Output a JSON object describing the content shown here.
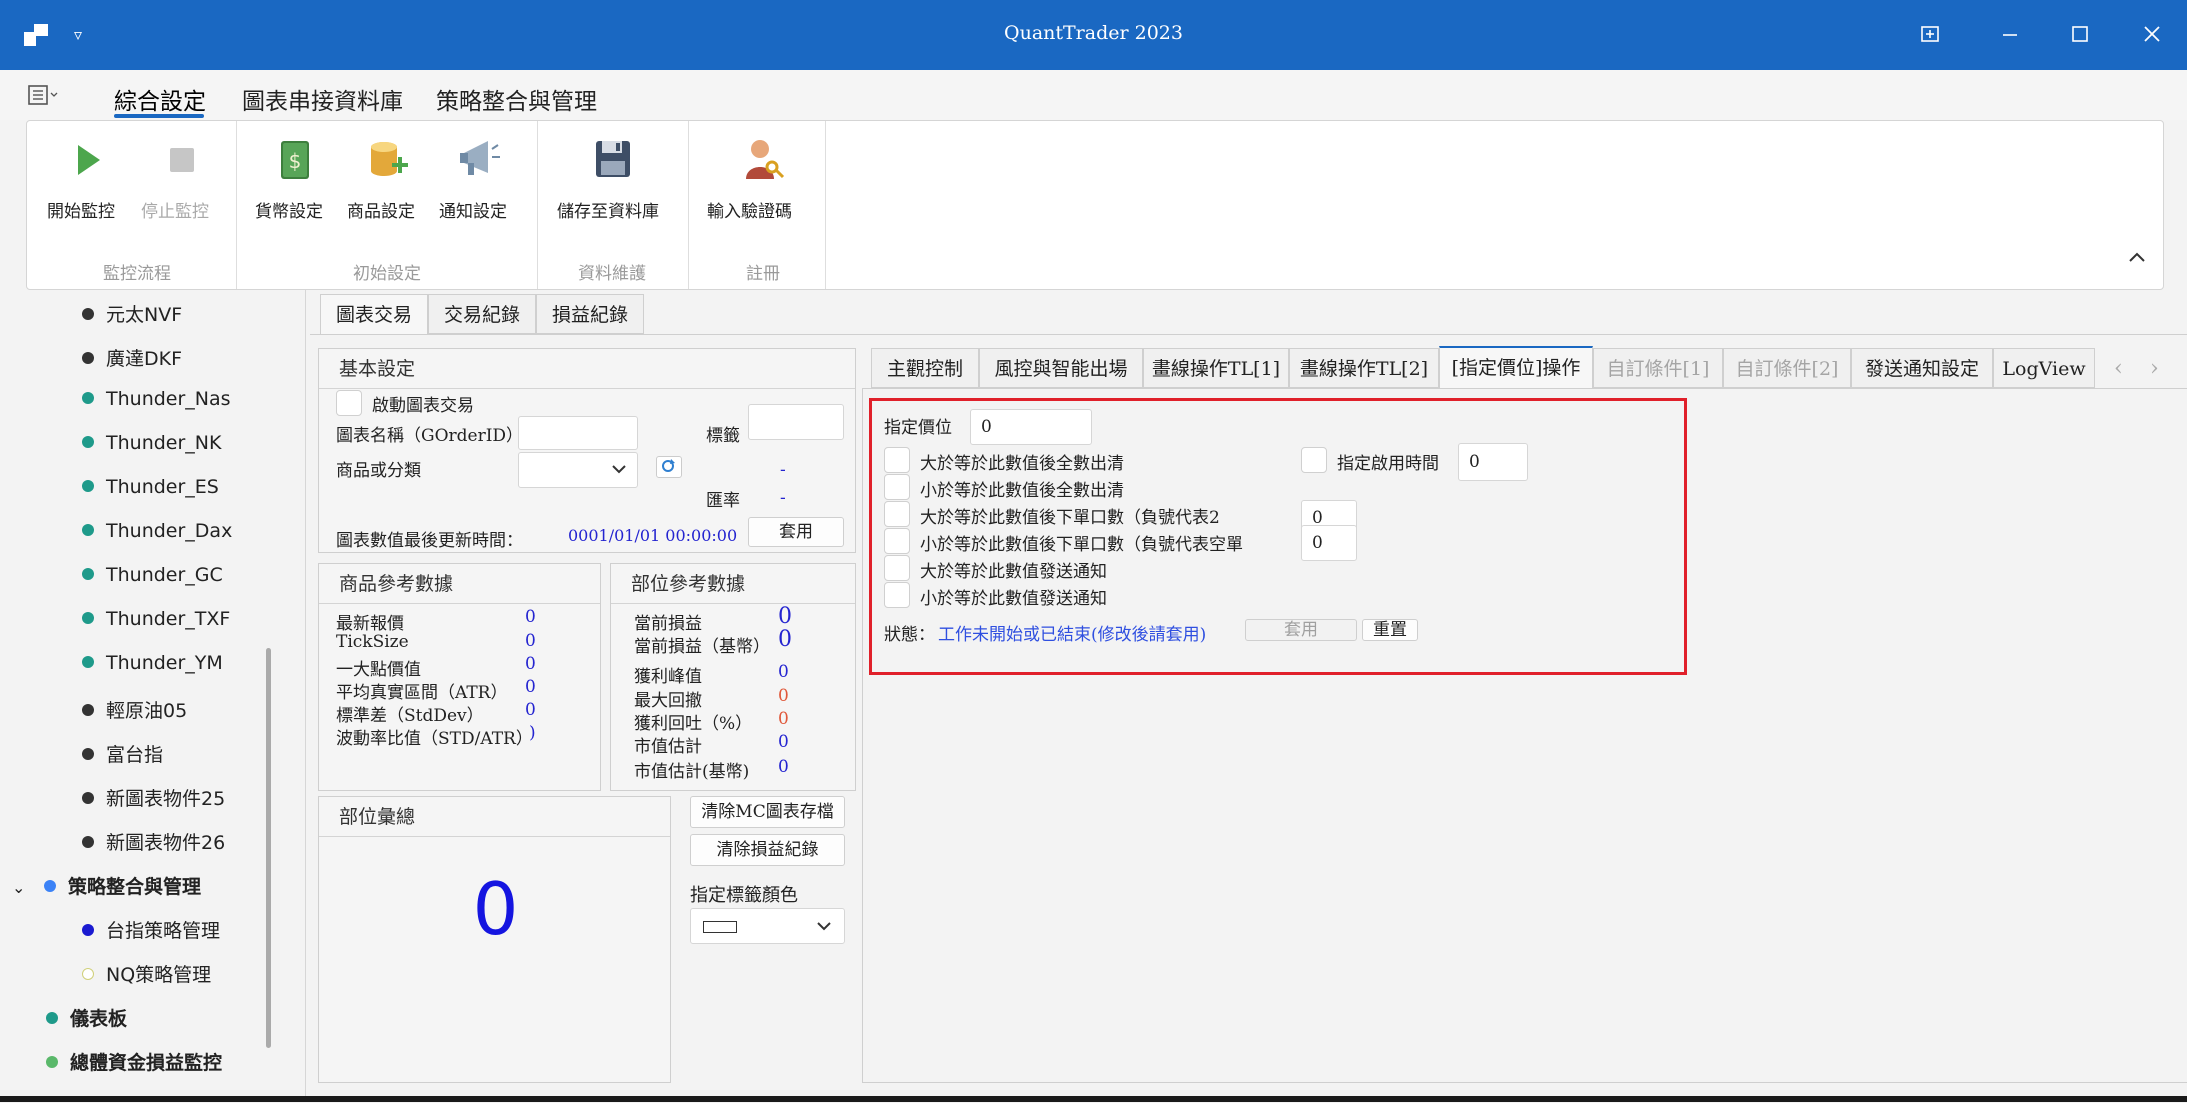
{
  "window": {
    "title": "QuantTrader 2023"
  },
  "menu": {
    "tabs": [
      "綜合設定",
      "圖表串接資料庫",
      "策略整合與管理"
    ]
  },
  "ribbon": {
    "buttons": [
      "開始監控",
      "停止監控",
      "貨幣設定",
      "商品設定",
      "通知設定",
      "儲存至資料庫",
      "輸入驗證碼"
    ],
    "groups": [
      "監控流程",
      "初始設定",
      "資料維護",
      "註冊"
    ]
  },
  "sidebar": {
    "items": [
      "元太NVF",
      "廣達DKF",
      "Thunder_Nas",
      "Thunder_NK",
      "Thunder_ES",
      "Thunder_Dax",
      "Thunder_GC",
      "Thunder_TXF",
      "Thunder_YM",
      "輕原油05",
      "富台指",
      "新圖表物件25",
      "新圖表物件26"
    ],
    "group_label": "策略整合與管理",
    "sub_items": [
      "台指策略管理",
      "NQ策略管理"
    ],
    "bottom_items": [
      "儀表板",
      "總體資金損益監控"
    ],
    "colors": {
      "dark": "#333333",
      "teal": "#1e9a8a",
      "blue": "#3b82f6",
      "navy": "#1a1ad0",
      "yellow_outline": "#e6e69a",
      "green": "#5ab86a"
    }
  },
  "main_tabs": [
    "圖表交易",
    "交易紀錄",
    "損益紀錄"
  ],
  "basic": {
    "title": "基本設定",
    "enable_chart_trading": "啟動圖表交易",
    "chart_name_label": "圖表名稱（GOrderID）",
    "tag_label": "標籤",
    "product_label": "商品或分類",
    "dash1": "-",
    "rate_label": "匯率",
    "dash2": "-",
    "update_time_label": "圖表數值最後更新時間：",
    "update_time_value": "0001/01/01 00:00:00",
    "apply": "套用"
  },
  "product_ref": {
    "title": "商品參考數據",
    "rows": [
      {
        "label": "最新報價",
        "value": "0"
      },
      {
        "label": "TickSize",
        "value": "0"
      },
      {
        "label": "一大點價值",
        "value": "0"
      },
      {
        "label": "平均真實區間（ATR）",
        "value": "0"
      },
      {
        "label": "標準差（StdDev）",
        "value": "0"
      },
      {
        "label": "波動率比值（STD/ATR）",
        "value": ")"
      }
    ]
  },
  "position_ref": {
    "title": "部位參考數據",
    "rows": [
      {
        "label": "當前損益",
        "value": "0"
      },
      {
        "label": "當前損益（基幣）",
        "value": "0"
      },
      {
        "label": "獲利峰值",
        "value": "0"
      },
      {
        "label": "最大回撤",
        "value": "0"
      },
      {
        "label": "獲利回吐（%）",
        "value": "0"
      },
      {
        "label": "市值估計",
        "value": "0"
      },
      {
        "label": "市值估計(基幣)",
        "value": "0"
      }
    ]
  },
  "position_total": {
    "title": "部位彙總",
    "value": "0"
  },
  "actions": {
    "clear_mc": "清除MC圖表存檔",
    "clear_pnl": "清除損益紀錄",
    "tag_color_label": "指定標籤顏色"
  },
  "right_tabs": [
    "主觀控制",
    "風控與智能出場",
    "畫線操作TL[1]",
    "畫線操作TL[2]",
    "[指定價位]操作",
    "自訂條件[1]",
    "自訂條件[2]",
    "發送通知設定",
    "LogView"
  ],
  "price_op": {
    "price_label": "指定價位",
    "price_value": "0",
    "options": [
      "大於等於此數值後全數出清",
      "小於等於此數值後全數出清",
      "大於等於此數值後下單口數（負號代表2",
      "小於等於此數值後下單口數（負號代表空單",
      "大於等於此數值發送通知",
      "小於等於此數值發送通知"
    ],
    "enable_time_label": "指定啟用時間",
    "enable_time_value": "0",
    "qty_up_value": "0",
    "qty_down_value": "0",
    "status_label": "狀態：",
    "status_text": "工作未開始或已結束(修改後請套用)",
    "apply": "套用",
    "reset": "重置"
  }
}
